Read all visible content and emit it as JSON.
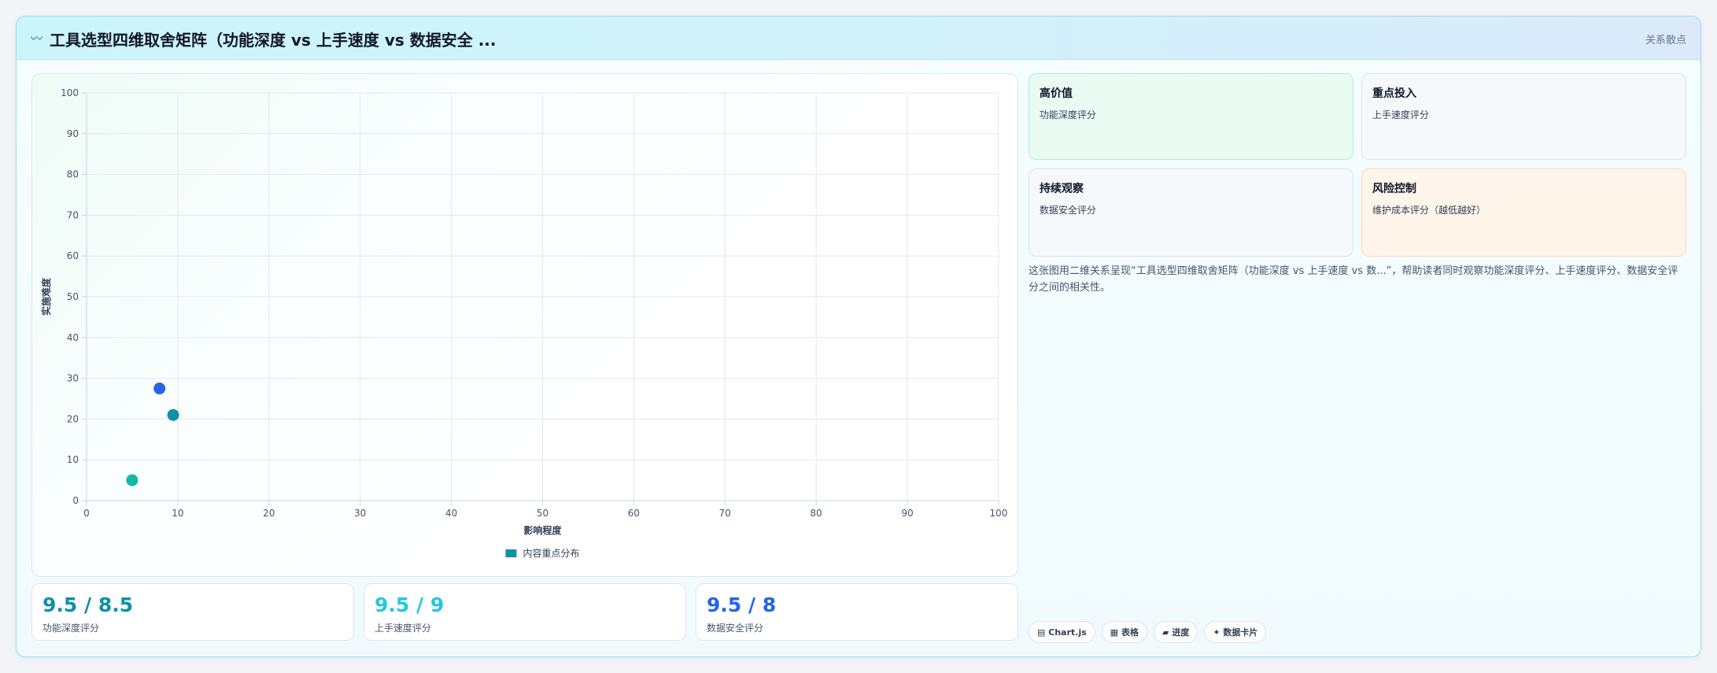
{
  "header": {
    "icon": "line-chart-icon",
    "title": "工具选型四维取舍矩阵（功能深度 vs 上手速度 vs 数据安全 ...",
    "badge": "关系散点"
  },
  "chart_data": {
    "type": "scatter",
    "title": "",
    "xlabel": "影响程度",
    "ylabel": "实施难度",
    "xlim": [
      0,
      100
    ],
    "ylim": [
      0,
      100
    ],
    "xticks": [
      "0",
      "10",
      "20",
      "30",
      "40",
      "50",
      "60",
      "70",
      "80",
      "90",
      "100"
    ],
    "yticks": [
      "0",
      "10",
      "20",
      "30",
      "40",
      "50",
      "60",
      "70",
      "80",
      "90",
      "100"
    ],
    "grid": true,
    "legend_position": "bottom",
    "series": [
      {
        "name": "内容重点分布",
        "color": "#0e91a6",
        "points": [
          {
            "x": 5,
            "y": 5,
            "color": "#14b8a6"
          },
          {
            "x": 8,
            "y": 27.5,
            "color": "#2563eb"
          },
          {
            "x": 9.5,
            "y": 21,
            "color": "#0e91a6"
          }
        ]
      }
    ]
  },
  "stats": [
    {
      "value": "9.5 / 8.5",
      "label": "功能深度评分",
      "color": "#0e91a6"
    },
    {
      "value": "9.5 / 9",
      "label": "上手速度评分",
      "color": "#22c9dd"
    },
    {
      "value": "9.5 / 8",
      "label": "数据安全评分",
      "color": "#2563eb"
    }
  ],
  "quadrants": [
    {
      "title": "高价值",
      "desc": "功能深度评分",
      "bg": "#e9fbf3",
      "border": "#b8eccf"
    },
    {
      "title": "重点投入",
      "desc": "上手速度评分",
      "bg": "#f6f9fc",
      "border": "#dbe3ea"
    },
    {
      "title": "持续观察",
      "desc": "数据安全评分",
      "bg": "#f6f9fc",
      "border": "#dbe3ea"
    },
    {
      "title": "风险控制",
      "desc": "维护成本评分（越低越好）",
      "bg": "#fff5ea",
      "border": "#f6d8b4"
    }
  ],
  "description": "这张图用二维关系呈现“工具选型四维取舍矩阵（功能深度 vs 上手速度 vs 数...”，帮助读者同时观察功能深度评分、上手速度评分、数据安全评分之间的相关性。",
  "tags": [
    {
      "icon": "chart-icon",
      "glyph": "▤",
      "label": "Chart.js"
    },
    {
      "icon": "table-icon",
      "glyph": "▦",
      "label": "表格"
    },
    {
      "icon": "progress-icon",
      "glyph": "▰",
      "label": "进度"
    },
    {
      "icon": "sparkle-icon",
      "glyph": "✦",
      "label": "数据卡片"
    }
  ]
}
